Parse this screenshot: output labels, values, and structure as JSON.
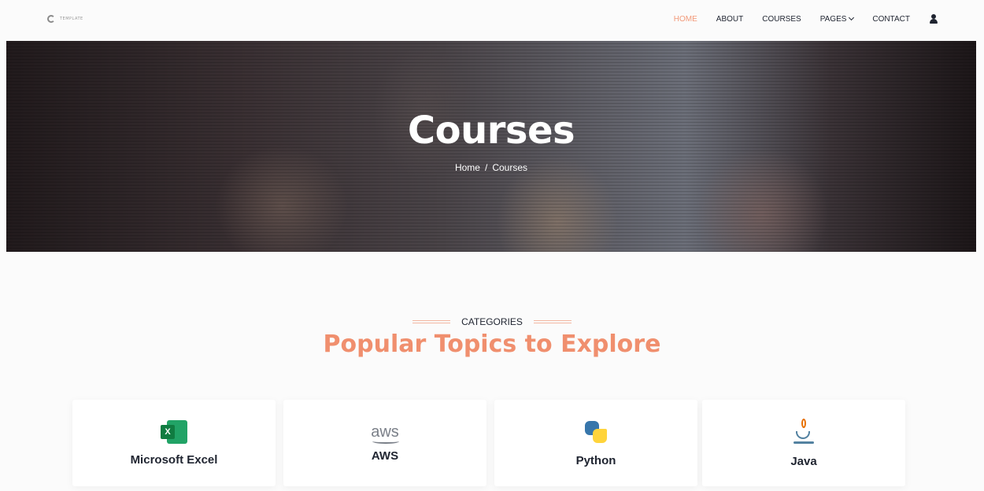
{
  "header": {
    "logo_text": "TEMPLATE",
    "nav": [
      {
        "label": "HOME",
        "active": true
      },
      {
        "label": "ABOUT"
      },
      {
        "label": "COURSES"
      },
      {
        "label": "PAGES",
        "has_dropdown": true
      },
      {
        "label": "CONTACT"
      }
    ],
    "accent_color": "#f29a7a"
  },
  "hero": {
    "title": "Courses",
    "breadcrumb": {
      "home": "Home",
      "separator": "/",
      "current": "Courses"
    }
  },
  "section": {
    "eyebrow": "CATEGORIES",
    "title": "Popular Topics to Explore",
    "title_color": "#f08f6e"
  },
  "categories": [
    {
      "label": "Microsoft Excel",
      "icon": "excel-icon"
    },
    {
      "label": "AWS",
      "icon": "aws-icon"
    },
    {
      "label": "Python",
      "icon": "python-icon"
    },
    {
      "label": "Java",
      "icon": "java-icon"
    }
  ]
}
